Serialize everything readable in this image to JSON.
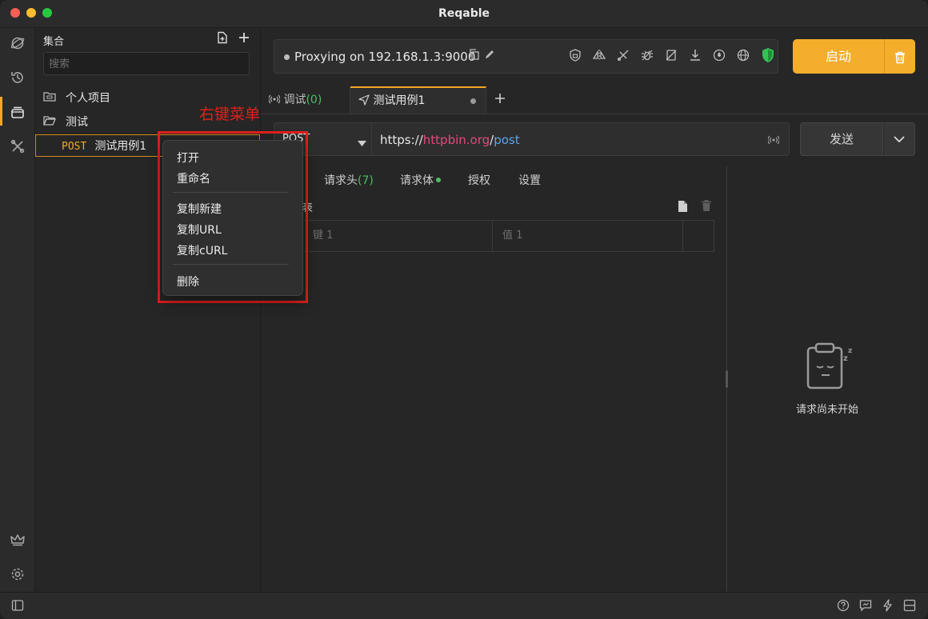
{
  "window": {
    "title": "Reqable"
  },
  "rail": {
    "icons": [
      "proxy-icon",
      "history-icon",
      "collections-icon",
      "tools-icon",
      "crown-icon",
      "settings-icon"
    ]
  },
  "collections": {
    "title": "集合",
    "search_placeholder": "搜索",
    "items": [
      {
        "icon": "folder-icon",
        "label": "个人项目"
      },
      {
        "icon": "folder-open-icon",
        "label": "测试"
      },
      {
        "method": "POST",
        "label": "测试用例1"
      }
    ]
  },
  "proxy": {
    "status": "Proxying on 192.168.1.3:9000"
  },
  "start_button": {
    "label": "启动"
  },
  "tabs": [
    {
      "label": "调试",
      "count": "(0)"
    },
    {
      "label": "测试用例1"
    }
  ],
  "request": {
    "method": "POST",
    "url_prefix": "https://",
    "url_host": "httpbin.org",
    "url_sep": "/",
    "url_path": "post",
    "send_label": "发送"
  },
  "subtabs": {
    "headers": "请求头",
    "headers_count": "(7)",
    "body": "请求体",
    "auth": "授权",
    "settings": "设置"
  },
  "body_section": {
    "label": "表",
    "key_placeholder": "键 1",
    "value_placeholder": "值 1"
  },
  "response": {
    "empty_text": "请求尚未开始"
  },
  "context_menu": {
    "open": "打开",
    "rename": "重命名",
    "duplicate": "复制新建",
    "copy_url": "复制URL",
    "copy_curl": "复制cURL",
    "delete": "删除"
  },
  "annotation": {
    "text": "右键菜单"
  },
  "colors": {
    "accent": "#f5ad2c",
    "annotation": "#e1201d",
    "url_host": "#e8467c",
    "url_path": "#5aa7ec",
    "success": "#49c060"
  }
}
